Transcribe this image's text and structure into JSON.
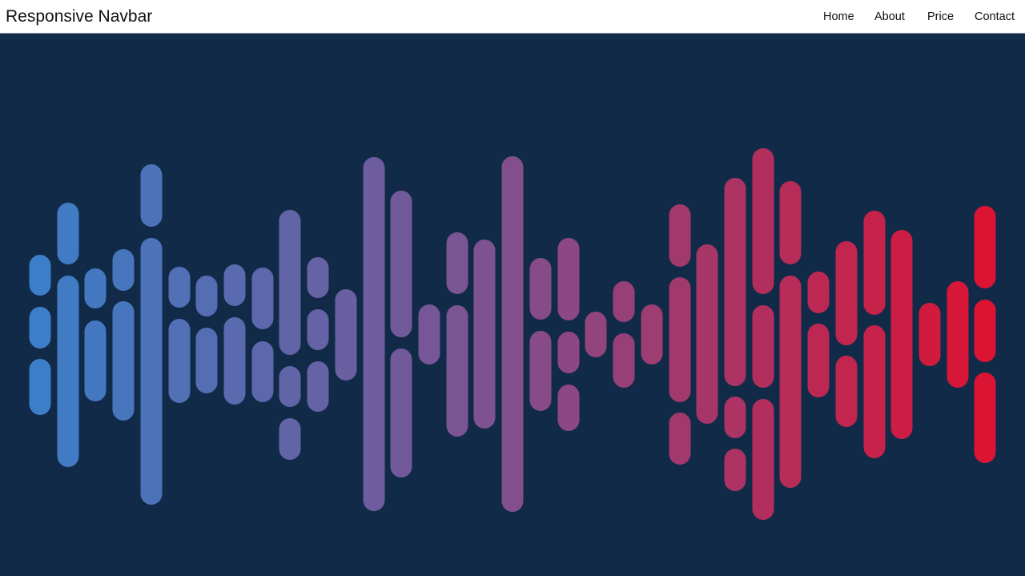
{
  "navbar": {
    "brand": "Responsive Navbar",
    "links": [
      {
        "label": "Home"
      },
      {
        "label": "About"
      },
      {
        "label": "Price"
      },
      {
        "label": "Contact"
      }
    ]
  },
  "colors": {
    "navbar_bg": "#ffffff",
    "hero_bg": "#112a48",
    "wave_start": "#3c7ec8",
    "wave_end": "#dc1434"
  }
}
